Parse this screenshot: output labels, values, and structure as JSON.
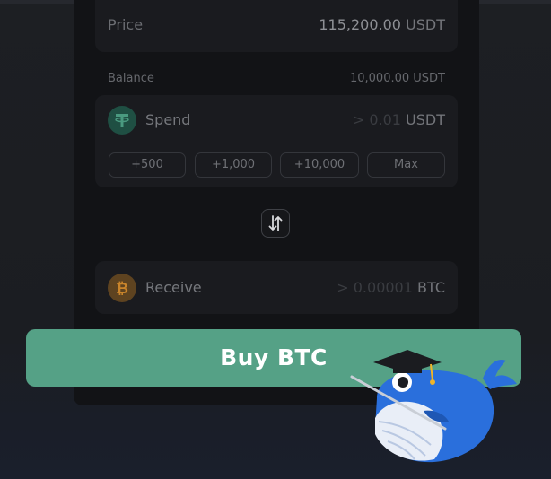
{
  "price": {
    "label": "Price",
    "value": "115,200.00",
    "unit": "USDT"
  },
  "balance": {
    "label": "Balance",
    "value": "10,000.00 USDT"
  },
  "spend": {
    "label": "Spend",
    "prefix": ">",
    "min": "0.01",
    "unit": "USDT",
    "quick_amounts": [
      "+500",
      "+1,000",
      "+10,000",
      "Max"
    ]
  },
  "receive": {
    "label": "Receive",
    "prefix": ">",
    "min": "0.00001",
    "unit": "BTC"
  },
  "buy_button": {
    "label": "Buy BTC"
  },
  "icons": {
    "spend_coin": "usdt-icon",
    "receive_coin": "btc-icon",
    "swap": "swap-arrows-icon",
    "mascot": "whale-graduate-mascot"
  },
  "colors": {
    "accent": "#55a186",
    "usdt": "#2a8c6f",
    "btc": "#c9842b"
  }
}
